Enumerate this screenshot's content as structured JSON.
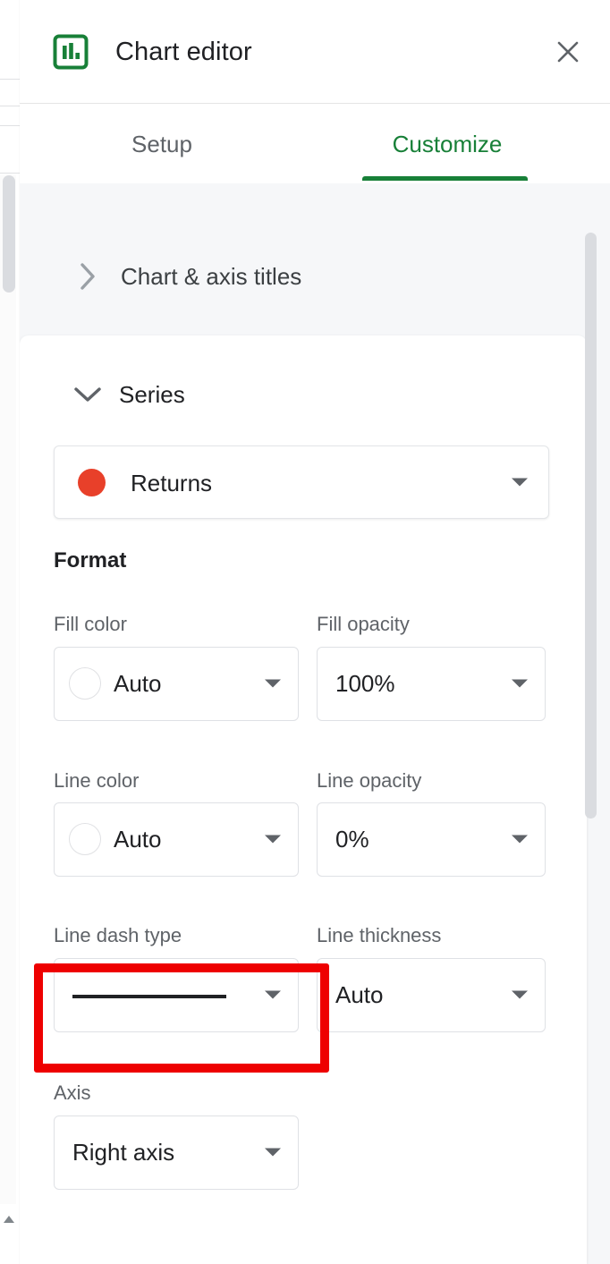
{
  "header": {
    "title": "Chart editor",
    "icon": "bar-chart-icon",
    "close_icon": "close-icon",
    "icon_color": "#188038"
  },
  "tabs": [
    {
      "label": "Setup",
      "active": false
    },
    {
      "label": "Customize",
      "active": true
    }
  ],
  "accent_color": "#188038",
  "sections": {
    "chart_axis_titles": {
      "label": "Chart & axis titles",
      "expanded": false,
      "chevron_icon": "chevron-right-icon"
    },
    "series": {
      "label": "Series",
      "expanded": true,
      "chevron_icon": "chevron-down-icon",
      "selected_series": {
        "label": "Returns",
        "color": "#E8402A",
        "caret_icon": "chevron-down-icon"
      },
      "format_heading": "Format",
      "fields": [
        {
          "label": "Fill color",
          "value": "Auto",
          "type": "color",
          "swatch": "none"
        },
        {
          "label": "Fill opacity",
          "value": "100%",
          "type": "text"
        },
        {
          "label": "Line color",
          "value": "Auto",
          "type": "color",
          "swatch": "none"
        },
        {
          "label": "Line opacity",
          "value": "0%",
          "type": "text"
        },
        {
          "label": "Line dash type",
          "value": "",
          "type": "dash"
        },
        {
          "label": "Line thickness",
          "value": "Auto",
          "type": "text"
        }
      ],
      "axis": {
        "label": "Axis",
        "value": "Right axis",
        "highlighted": true,
        "highlight_color": "#ee0000"
      }
    }
  },
  "scrollbars": {
    "panel_scrollbar": "vertical-scrollbar-thumb",
    "sheet_scrollbar": "vertical-scrollbar-thumb",
    "sheet_scroll_arrow": "scroll-up-arrow-icon"
  }
}
